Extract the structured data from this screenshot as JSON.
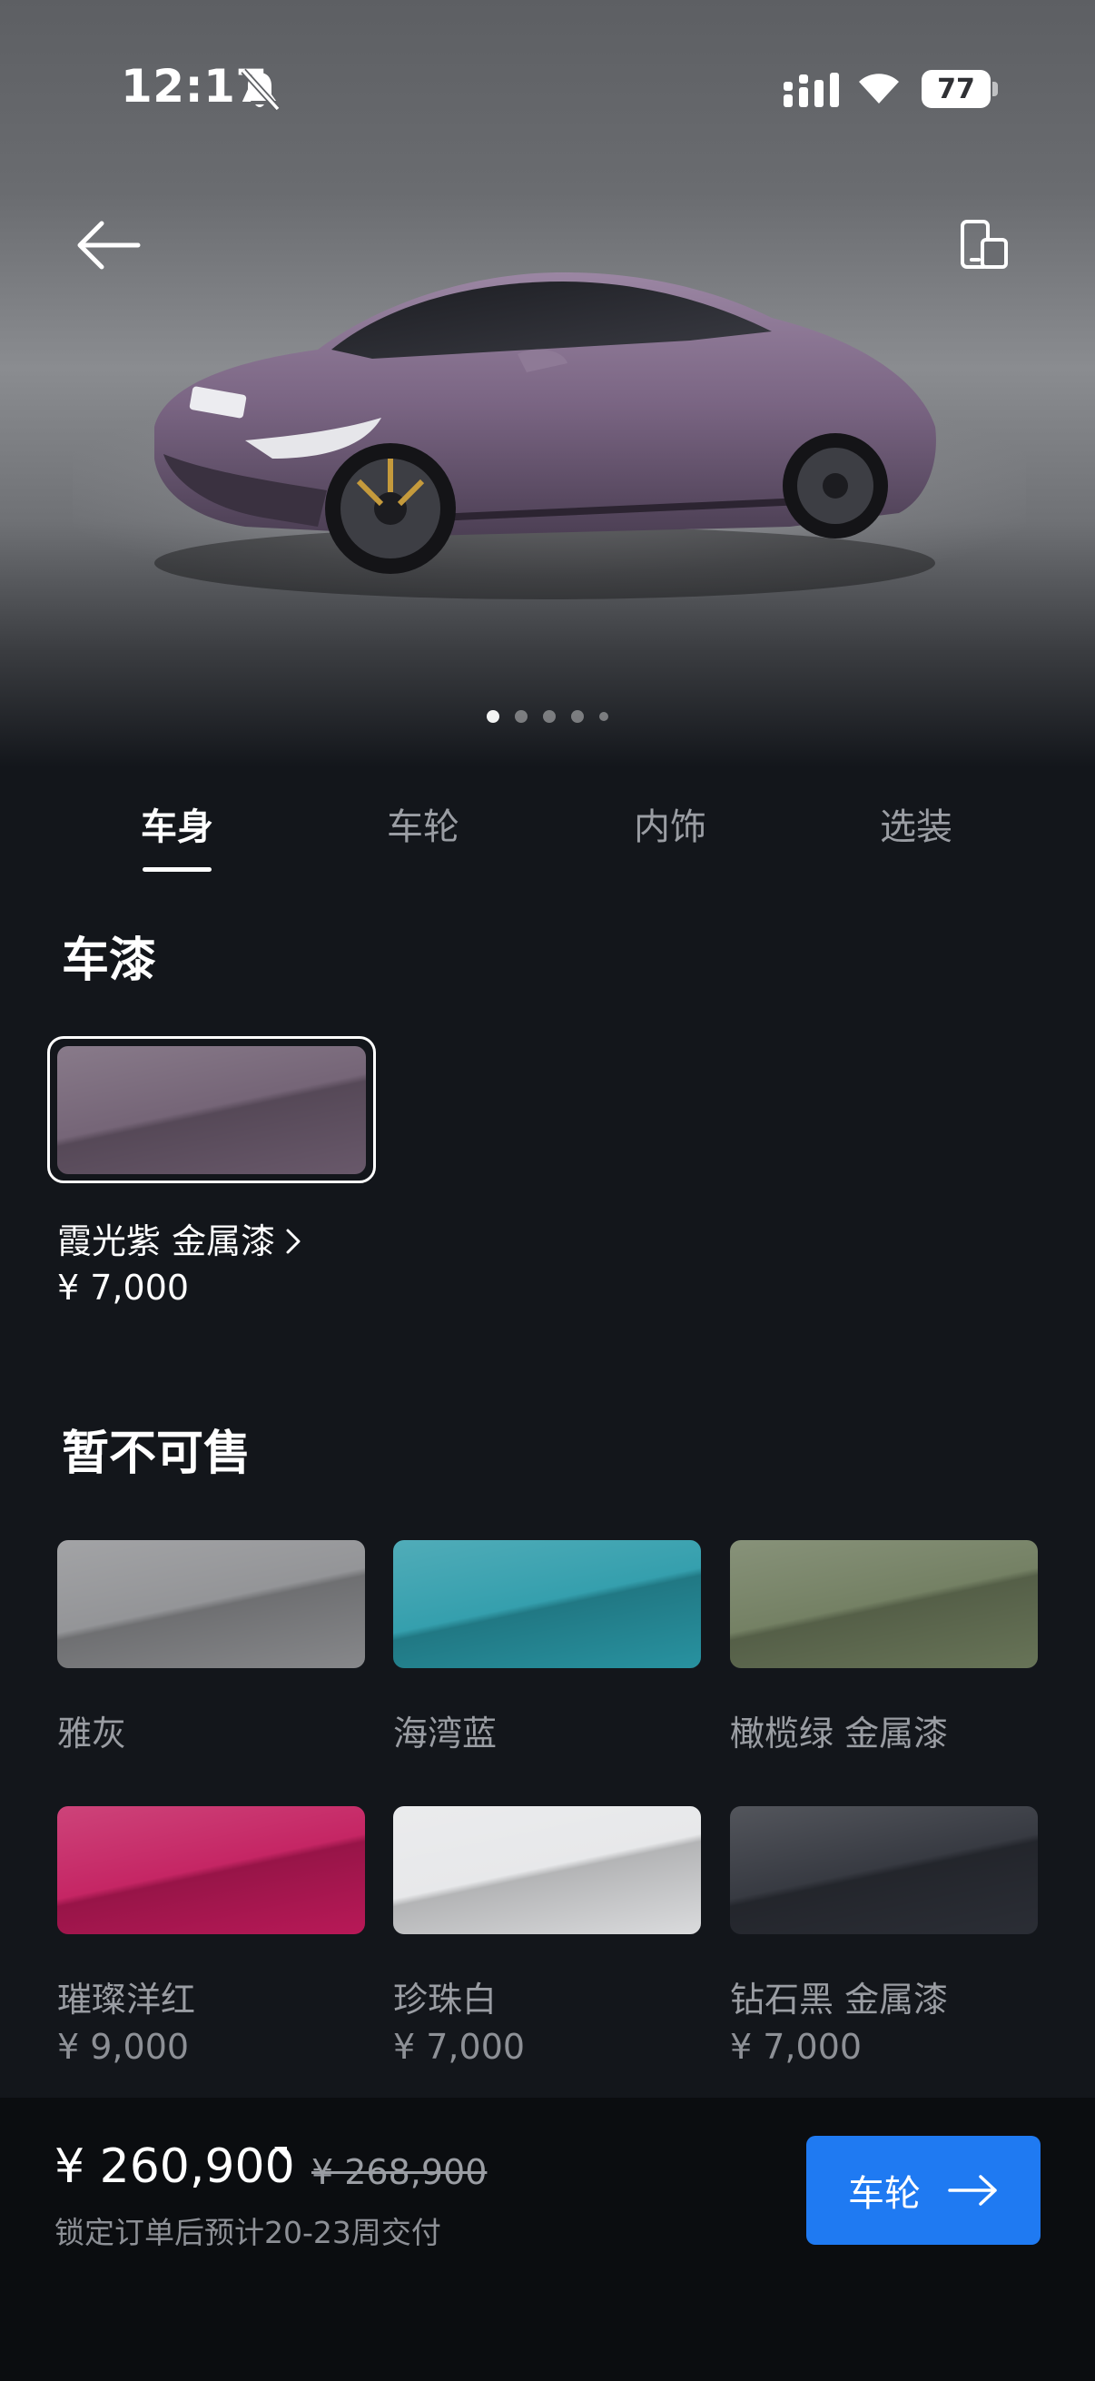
{
  "status_bar": {
    "time": "12:17",
    "battery": "77"
  },
  "tabs": [
    {
      "label": "车身",
      "active": true
    },
    {
      "label": "车轮",
      "active": false
    },
    {
      "label": "内饰",
      "active": false
    },
    {
      "label": "选装",
      "active": false
    }
  ],
  "paint_section": {
    "title": "车漆",
    "selected": {
      "name": "霞光紫 金属漆",
      "price": "¥ 7,000",
      "color": "#6e5d70"
    }
  },
  "unavailable_section": {
    "title": "暂不可售",
    "colors": [
      {
        "name": "雅灰",
        "price": "",
        "color": "#8e8f92"
      },
      {
        "name": "海湾蓝",
        "price": "",
        "color": "#2a9aa9"
      },
      {
        "name": "橄榄绿 金属漆",
        "price": "",
        "color": "#6d7a5c"
      },
      {
        "name": "璀璨洋红",
        "price": "¥ 9,000",
        "color": "#c21a5c"
      },
      {
        "name": "珍珠白",
        "price": "¥ 7,000",
        "color": "#e6e7e9"
      },
      {
        "name": "钻石黑 金属漆",
        "price": "¥ 7,000",
        "color": "#2d3038"
      }
    ]
  },
  "footer": {
    "total_price": "¥ 260,900",
    "original_price": "¥ 268,900",
    "delivery_note": "锁定订单后预计20-23周交付",
    "next_button_label": "车轮"
  },
  "carousel": {
    "count": 5,
    "active_index": 0
  },
  "brand_colors": {
    "accent": "#1f7af2",
    "background": "#13161b"
  }
}
